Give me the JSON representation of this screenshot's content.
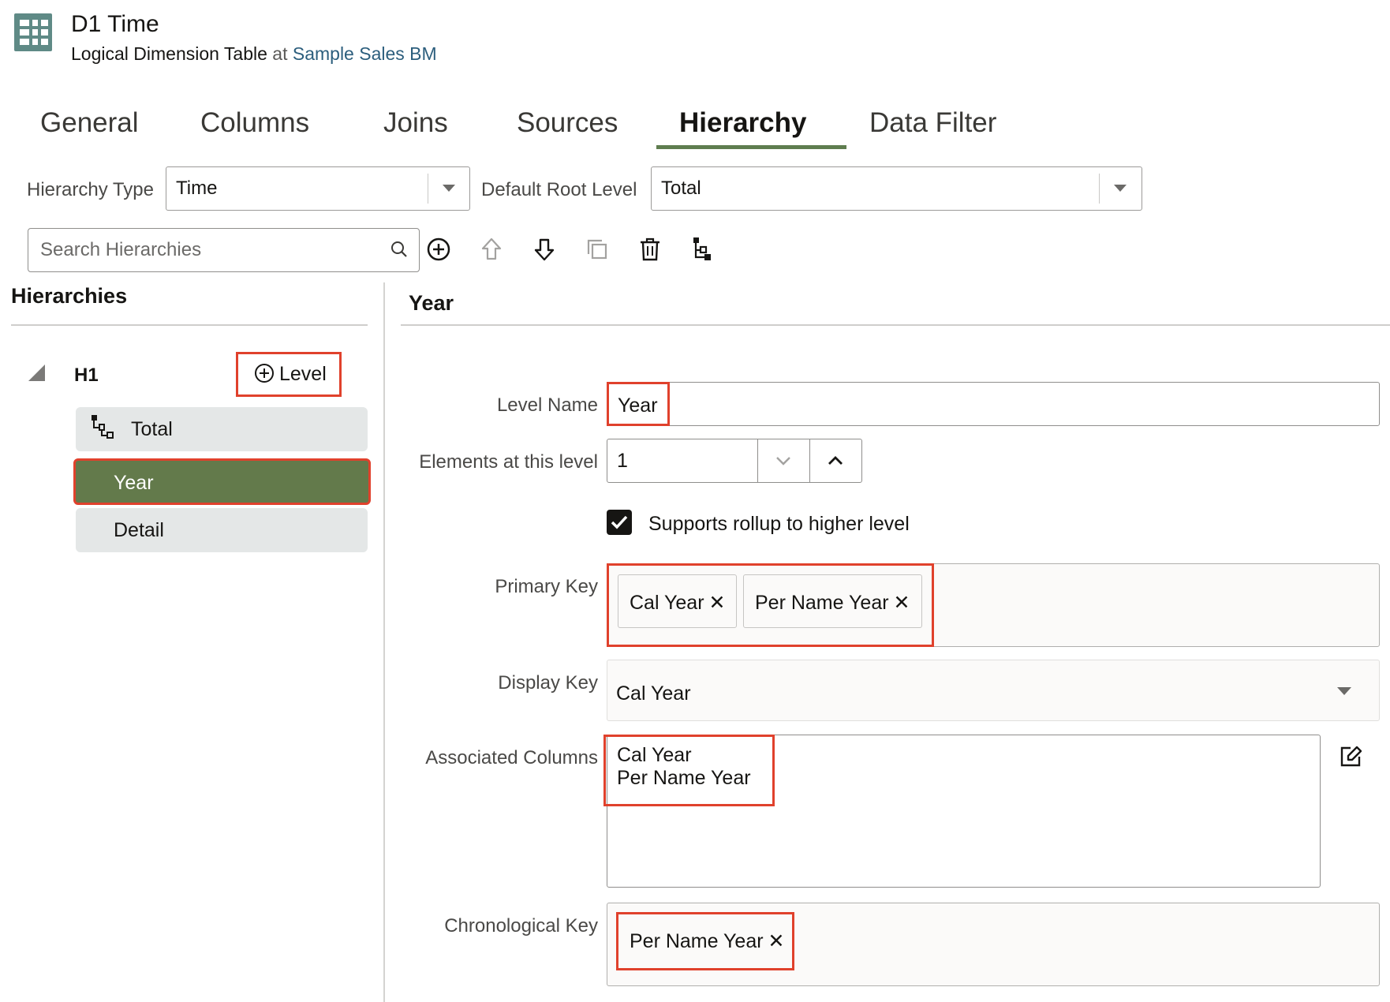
{
  "header": {
    "title": "D1 Time",
    "subtitle_prefix": "Logical Dimension Table",
    "subtitle_at": "at",
    "subtitle_link": "Sample Sales BM",
    "icon": "table-icon"
  },
  "tabs": [
    {
      "label": "General"
    },
    {
      "label": "Columns"
    },
    {
      "label": "Joins"
    },
    {
      "label": "Sources"
    },
    {
      "label": "Hierarchy",
      "active": true
    },
    {
      "label": "Data Filter"
    }
  ],
  "hierarchy_type": {
    "label": "Hierarchy Type",
    "value": "Time"
  },
  "default_root_level": {
    "label": "Default Root Level",
    "value": "Total"
  },
  "search": {
    "placeholder": "Search Hierarchies",
    "icon": "search-icon"
  },
  "toolbar": {
    "icons": [
      "add-circle-icon",
      "move-up-icon",
      "move-down-icon",
      "duplicate-icon",
      "delete-icon",
      "hierarchy-icon"
    ]
  },
  "left_panel": {
    "heading": "Hierarchies",
    "hierarchy": {
      "name": "H1",
      "add_level_label": "Level"
    },
    "levels": [
      {
        "label": "Total",
        "icon": "hierarchy-icon"
      },
      {
        "label": "Year",
        "selected": true
      },
      {
        "label": "Detail"
      }
    ]
  },
  "detail": {
    "heading": "Year",
    "level_name": {
      "label": "Level Name",
      "value": "Year"
    },
    "elements": {
      "label": "Elements at this level",
      "value": "1"
    },
    "rollup": {
      "label": "Supports rollup to higher level",
      "checked": true
    },
    "primary_key": {
      "label": "Primary Key",
      "chips": [
        "Cal Year",
        "Per Name Year"
      ]
    },
    "display_key": {
      "label": "Display Key",
      "value": "Cal Year"
    },
    "associated_columns": {
      "label": "Associated Columns",
      "lines": [
        "Cal Year",
        "Per Name Year"
      ]
    },
    "chronological_key": {
      "label": "Chronological Key",
      "chips": [
        "Per Name Year"
      ]
    }
  },
  "colors": {
    "accent_green": "#637a4b",
    "tab_underline": "#5f7d4f",
    "highlight_red": "#e0412c",
    "link_blue": "#2c5e7d",
    "icon_teal": "#5f8a86"
  }
}
